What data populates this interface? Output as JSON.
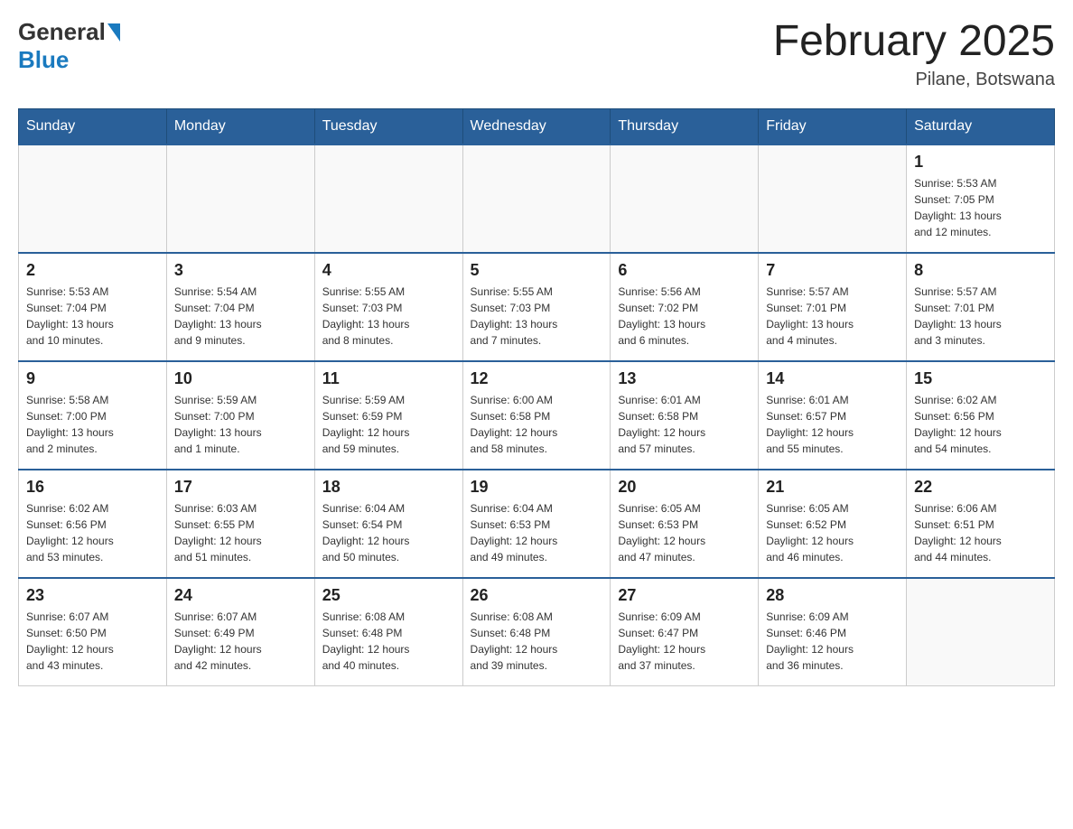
{
  "header": {
    "logo": {
      "general": "General",
      "blue": "Blue"
    },
    "title": "February 2025",
    "subtitle": "Pilane, Botswana"
  },
  "weekdays": [
    "Sunday",
    "Monday",
    "Tuesday",
    "Wednesday",
    "Thursday",
    "Friday",
    "Saturday"
  ],
  "weeks": [
    [
      {
        "day": "",
        "info": ""
      },
      {
        "day": "",
        "info": ""
      },
      {
        "day": "",
        "info": ""
      },
      {
        "day": "",
        "info": ""
      },
      {
        "day": "",
        "info": ""
      },
      {
        "day": "",
        "info": ""
      },
      {
        "day": "1",
        "info": "Sunrise: 5:53 AM\nSunset: 7:05 PM\nDaylight: 13 hours\nand 12 minutes."
      }
    ],
    [
      {
        "day": "2",
        "info": "Sunrise: 5:53 AM\nSunset: 7:04 PM\nDaylight: 13 hours\nand 10 minutes."
      },
      {
        "day": "3",
        "info": "Sunrise: 5:54 AM\nSunset: 7:04 PM\nDaylight: 13 hours\nand 9 minutes."
      },
      {
        "day": "4",
        "info": "Sunrise: 5:55 AM\nSunset: 7:03 PM\nDaylight: 13 hours\nand 8 minutes."
      },
      {
        "day": "5",
        "info": "Sunrise: 5:55 AM\nSunset: 7:03 PM\nDaylight: 13 hours\nand 7 minutes."
      },
      {
        "day": "6",
        "info": "Sunrise: 5:56 AM\nSunset: 7:02 PM\nDaylight: 13 hours\nand 6 minutes."
      },
      {
        "day": "7",
        "info": "Sunrise: 5:57 AM\nSunset: 7:01 PM\nDaylight: 13 hours\nand 4 minutes."
      },
      {
        "day": "8",
        "info": "Sunrise: 5:57 AM\nSunset: 7:01 PM\nDaylight: 13 hours\nand 3 minutes."
      }
    ],
    [
      {
        "day": "9",
        "info": "Sunrise: 5:58 AM\nSunset: 7:00 PM\nDaylight: 13 hours\nand 2 minutes."
      },
      {
        "day": "10",
        "info": "Sunrise: 5:59 AM\nSunset: 7:00 PM\nDaylight: 13 hours\nand 1 minute."
      },
      {
        "day": "11",
        "info": "Sunrise: 5:59 AM\nSunset: 6:59 PM\nDaylight: 12 hours\nand 59 minutes."
      },
      {
        "day": "12",
        "info": "Sunrise: 6:00 AM\nSunset: 6:58 PM\nDaylight: 12 hours\nand 58 minutes."
      },
      {
        "day": "13",
        "info": "Sunrise: 6:01 AM\nSunset: 6:58 PM\nDaylight: 12 hours\nand 57 minutes."
      },
      {
        "day": "14",
        "info": "Sunrise: 6:01 AM\nSunset: 6:57 PM\nDaylight: 12 hours\nand 55 minutes."
      },
      {
        "day": "15",
        "info": "Sunrise: 6:02 AM\nSunset: 6:56 PM\nDaylight: 12 hours\nand 54 minutes."
      }
    ],
    [
      {
        "day": "16",
        "info": "Sunrise: 6:02 AM\nSunset: 6:56 PM\nDaylight: 12 hours\nand 53 minutes."
      },
      {
        "day": "17",
        "info": "Sunrise: 6:03 AM\nSunset: 6:55 PM\nDaylight: 12 hours\nand 51 minutes."
      },
      {
        "day": "18",
        "info": "Sunrise: 6:04 AM\nSunset: 6:54 PM\nDaylight: 12 hours\nand 50 minutes."
      },
      {
        "day": "19",
        "info": "Sunrise: 6:04 AM\nSunset: 6:53 PM\nDaylight: 12 hours\nand 49 minutes."
      },
      {
        "day": "20",
        "info": "Sunrise: 6:05 AM\nSunset: 6:53 PM\nDaylight: 12 hours\nand 47 minutes."
      },
      {
        "day": "21",
        "info": "Sunrise: 6:05 AM\nSunset: 6:52 PM\nDaylight: 12 hours\nand 46 minutes."
      },
      {
        "day": "22",
        "info": "Sunrise: 6:06 AM\nSunset: 6:51 PM\nDaylight: 12 hours\nand 44 minutes."
      }
    ],
    [
      {
        "day": "23",
        "info": "Sunrise: 6:07 AM\nSunset: 6:50 PM\nDaylight: 12 hours\nand 43 minutes."
      },
      {
        "day": "24",
        "info": "Sunrise: 6:07 AM\nSunset: 6:49 PM\nDaylight: 12 hours\nand 42 minutes."
      },
      {
        "day": "25",
        "info": "Sunrise: 6:08 AM\nSunset: 6:48 PM\nDaylight: 12 hours\nand 40 minutes."
      },
      {
        "day": "26",
        "info": "Sunrise: 6:08 AM\nSunset: 6:48 PM\nDaylight: 12 hours\nand 39 minutes."
      },
      {
        "day": "27",
        "info": "Sunrise: 6:09 AM\nSunset: 6:47 PM\nDaylight: 12 hours\nand 37 minutes."
      },
      {
        "day": "28",
        "info": "Sunrise: 6:09 AM\nSunset: 6:46 PM\nDaylight: 12 hours\nand 36 minutes."
      },
      {
        "day": "",
        "info": ""
      }
    ]
  ]
}
